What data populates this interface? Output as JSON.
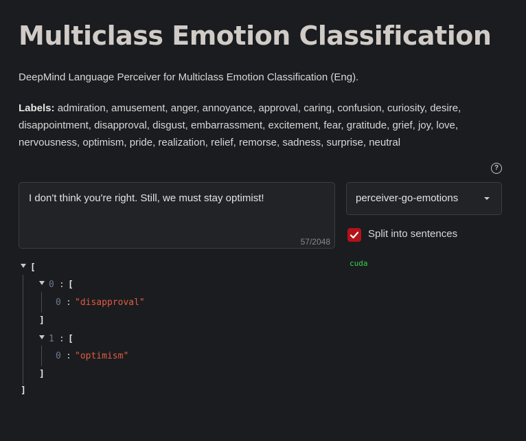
{
  "header": {
    "title": "Multiclass Emotion Classification",
    "subtitle": "DeepMind Language Perceiver for Multiclass Emotion Classification (Eng).",
    "labels_prefix": "Labels:",
    "labels_list": "admiration, amusement, anger, annoyance, approval, caring, confusion, curiosity, desire, disappointment, disapproval, disgust, embarrassment, excitement, fear, gratitude, grief, joy, love, nervousness, optimism, pride, realization, relief, remorse, sadness, surprise, neutral"
  },
  "input": {
    "value": "I don't think you're right. Still, we must stay optimist!",
    "char_count": "57/2048"
  },
  "model_select": {
    "selected": "perceiver-go-emotions"
  },
  "split_checkbox": {
    "label": "Split into sentences",
    "checked": true
  },
  "device": "cuda",
  "icons": {
    "help": "help-icon",
    "caret": "chevron-down-icon",
    "check": "check-icon",
    "collapse": "triangle-down-icon"
  },
  "colors": {
    "background": "#1b1c1f",
    "accent": "#b3121a",
    "string": "#e05d44",
    "device": "#39d353"
  },
  "json_output": {
    "open_bracket": "[",
    "close_bracket": "]",
    "colon": ":",
    "groups": [
      {
        "index": "0",
        "items": [
          {
            "index": "0",
            "value": "\"disapproval\""
          }
        ]
      },
      {
        "index": "1",
        "items": [
          {
            "index": "0",
            "value": "\"optimism\""
          }
        ]
      }
    ]
  }
}
